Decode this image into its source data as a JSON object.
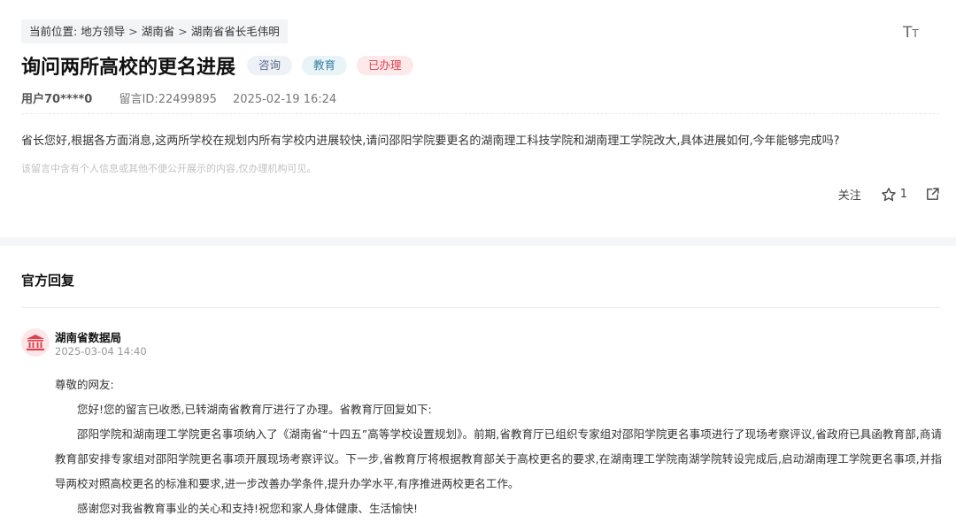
{
  "breadcrumb": {
    "label": "当前位置:",
    "items": [
      "地方领导",
      "湖南省",
      "湖南省省长毛伟明"
    ],
    "separator": ">"
  },
  "font_toggle": {
    "label_big": "T",
    "label_small": "T"
  },
  "message": {
    "title": "询问两所高校的更名进展",
    "tags": [
      "咨询",
      "教育",
      "已办理"
    ],
    "user": "用户70****0",
    "message_id": "留言ID:22499895",
    "datetime": "2025-02-19 16:24",
    "content": "省长您好,根据各方面消息,这两所学校在规划内所有学校内进展较快,请问邵阳学院要更名的湖南理工科技学院和湖南理工学院改大,具体进展如何,今年能够完成吗?",
    "privacy_note": "该留言中含有个人信息或其他不便公开展示的内容,仅办理机构可见。"
  },
  "actions": {
    "follow_label": "关注",
    "like_count": "1"
  },
  "reply": {
    "heading": "官方回复",
    "org_name": "湖南省数据局",
    "datetime": "2025-03-04 14:40",
    "greeting": "尊敬的网友:",
    "p1": "您好!您的留言已收悉,已转湖南省教育厅进行了办理。省教育厅回复如下:",
    "p2": "邵阳学院和湖南理工学院更名事项纳入了《湖南省“十四五”高等学校设置规划》。前期,省教育厅已组织专家组对邵阳学院更名事项进行了现场考察评议,省政府已具函教育部,商请教育部安排专家组对邵阳学院更名事项开展现场考察评议。下一步,省教育厅将根据教育部关于高校更名的要求,在湖南理工学院南湖学院转设完成后,启动湖南理工学院更名事项,并指导两校对照高校更名的标准和要求,进一步改善办学条件,提升办学水平,有序推进两校更名工作。",
    "p3": "感谢您对我省教育事业的关心和支持!祝您和家人身体健康、生活愉快!"
  },
  "colors": {
    "tag_done": "#e2404f",
    "tag_edu": "#3a7ea0",
    "tag_consult": "#5a6b8c",
    "org_icon": "#e2404f"
  }
}
